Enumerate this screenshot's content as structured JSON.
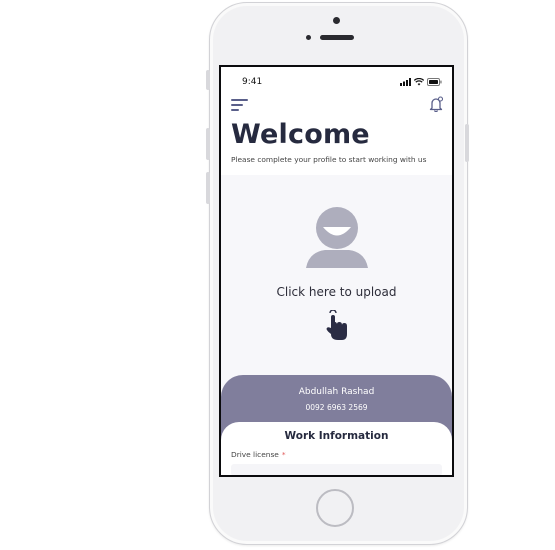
{
  "status_bar": {
    "time": "9:41",
    "icons": [
      "signal-icon",
      "wifi-icon",
      "battery-icon"
    ]
  },
  "header": {
    "menu_icon": "menu-icon",
    "bell_icon": "notification-bell-icon"
  },
  "welcome": {
    "title": "Welcome",
    "subtitle": "Please complete your profile to start working with us"
  },
  "upload": {
    "avatar_icon": "avatar-placeholder-icon",
    "label": "Click here to upload",
    "hand_icon": "tap-hand-icon"
  },
  "profile": {
    "name": "Abdullah Rashad",
    "phone": "0092 6963 2569"
  },
  "work": {
    "title": "Work Information",
    "drive_license_label": "Drive license",
    "required_mark": "*"
  },
  "colors": {
    "title": "#262a3f",
    "card": "#807e9c",
    "avatar": "#aeaebd",
    "upload_bg": "#f7f7fa",
    "required": "#e05757"
  }
}
